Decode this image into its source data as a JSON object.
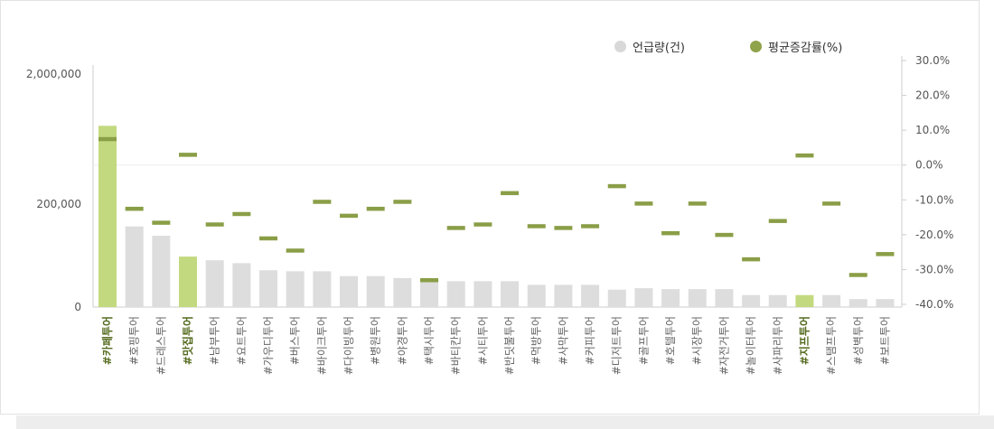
{
  "legend": {
    "bar_label": "언급량(건)",
    "line_label": "평균증감률(%)"
  },
  "colors": {
    "bar_default": "#dddddd",
    "bar_highlight": "#c3d97f",
    "marker": "#8a9e47",
    "highlight_text": "#556b1f",
    "legend_bar": "#d8d8d8",
    "legend_line": "#8fa34b"
  },
  "chart_data": {
    "type": "bar",
    "left_axis": {
      "tick_labels": [
        "2,000,000",
        "200,000",
        "0"
      ],
      "scale": "log",
      "ylim": [
        0,
        2000000
      ]
    },
    "right_axis": {
      "tick_labels": [
        "30.0%",
        "20.0%",
        "10.0%",
        "0.0%",
        "-10.0%",
        "-20.0%",
        "-30.0%",
        "-40.0%"
      ],
      "ylim": [
        -40,
        30
      ]
    },
    "categories": [
      "#카페투어",
      "#호핑투어",
      "#드레스투어",
      "#맛집투어",
      "#남부투어",
      "#요트투어",
      "#가우디투어",
      "#버스투어",
      "#바이크투어",
      "#다이빙투어",
      "#병원투어",
      "#야경투어",
      "#택시투어",
      "#바티칸투어",
      "#시티투어",
      "#반딧불투어",
      "#먹방투어",
      "#사막투어",
      "#커피투어",
      "#디저트투어",
      "#골프투어",
      "#호텔투어",
      "#시장투어",
      "#자전거투어",
      "#놀이터투어",
      "#사파리투어",
      "#지프투어",
      "#스탬프투어",
      "#성벽투어",
      "#보트투어"
    ],
    "highlighted": [
      "#카페투어",
      "#맛집투어",
      "#지프투어"
    ],
    "series": [
      {
        "name": "언급량(건)",
        "type": "bar",
        "values": [
          800000,
          75000,
          50000,
          20000,
          17000,
          15000,
          11000,
          10500,
          10500,
          8500,
          8500,
          7800,
          7800,
          6800,
          6800,
          6800,
          5800,
          5800,
          5800,
          4700,
          5000,
          4800,
          4800,
          4800,
          3700,
          3700,
          3700,
          3700,
          3100,
          3100
        ]
      },
      {
        "name": "평균증감률(%)",
        "type": "marker",
        "values": [
          7.5,
          -12.5,
          -16.5,
          3.0,
          -17.0,
          -14.0,
          -21.0,
          -24.5,
          -10.5,
          -14.5,
          -12.5,
          -10.5,
          -33.0,
          -18.0,
          -17.0,
          -8.0,
          -17.5,
          -18.0,
          -17.5,
          -6.0,
          -11.0,
          -19.5,
          -11.0,
          -20.0,
          -27.0,
          -16.0,
          2.8,
          -11.0,
          -31.5,
          -25.5
        ]
      }
    ],
    "grid": false
  }
}
